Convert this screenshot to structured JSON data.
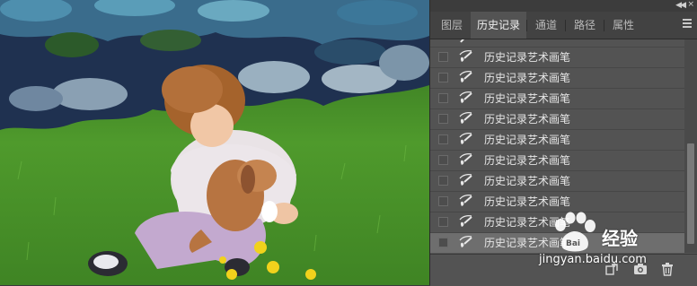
{
  "panel": {
    "tabs": [
      {
        "label": "图层"
      },
      {
        "label": "历史记录"
      },
      {
        "label": "通道"
      },
      {
        "label": "路径"
      },
      {
        "label": "属性"
      }
    ],
    "active_tab": "历史记录"
  },
  "history": {
    "items": [
      {
        "label": "历史记录艺术画笔"
      },
      {
        "label": "历史记录艺术画笔"
      },
      {
        "label": "历史记录艺术画笔"
      },
      {
        "label": "历史记录艺术画笔"
      },
      {
        "label": "历史记录艺术画笔"
      },
      {
        "label": "历史记录艺术画笔"
      },
      {
        "label": "历史记录艺术画笔"
      },
      {
        "label": "历史记录艺术画笔"
      },
      {
        "label": "历史记录艺术画笔"
      },
      {
        "label": "历史记录艺术画笔"
      }
    ]
  },
  "footer": {
    "icons": [
      "new-document-from-state-icon",
      "snapshot-camera-icon",
      "trash-icon"
    ]
  },
  "watermark": {
    "logo_text": "Bai",
    "text": "经验",
    "url": "jingyan.baidu.com"
  },
  "colors": {
    "panel_bg": "#535353",
    "tab_bar_bg": "#424242",
    "selected_row": "#6e6e6e",
    "text": "#e6e6e6"
  }
}
